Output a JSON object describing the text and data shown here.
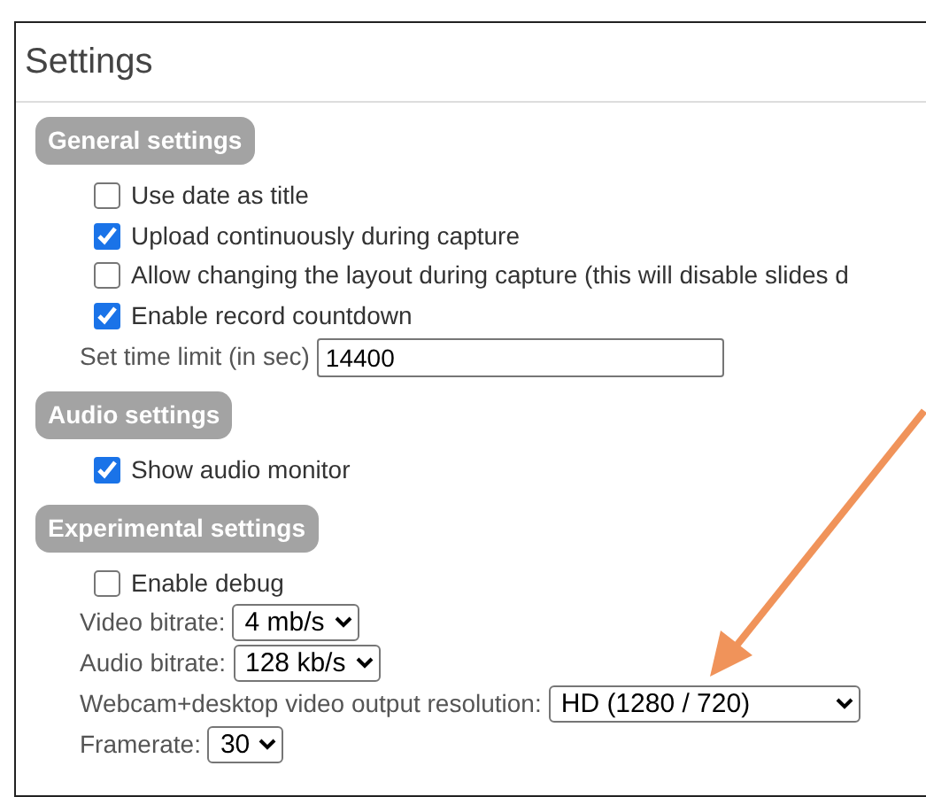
{
  "panel": {
    "title": "Settings"
  },
  "sections": [
    {
      "title": "General settings",
      "rows": [
        {
          "kind": "checkbox",
          "label": "Use date as title",
          "checked": false
        },
        {
          "kind": "checkbox",
          "label": "Upload continuously during capture",
          "checked": true
        },
        {
          "kind": "checkbox",
          "label": "Allow changing the layout during capture (this will disable slides d",
          "checked": false
        },
        {
          "kind": "checkbox",
          "label": "Enable record countdown",
          "checked": true
        },
        {
          "kind": "text",
          "label": "Set time limit (in sec)",
          "value": "14400"
        }
      ]
    },
    {
      "title": "Audio settings",
      "rows": [
        {
          "kind": "checkbox",
          "label": "Show audio monitor",
          "checked": true
        }
      ]
    },
    {
      "title": "Experimental settings",
      "rows": [
        {
          "kind": "checkbox",
          "label": "Enable debug",
          "checked": false
        },
        {
          "kind": "select",
          "label": "Video bitrate:",
          "value": "4 mb/s"
        },
        {
          "kind": "select",
          "label": "Audio bitrate:",
          "value": "128 kb/s"
        },
        {
          "kind": "select",
          "label": "Webcam+desktop video output resolution:",
          "value": "HD (1280 / 720)"
        },
        {
          "kind": "select",
          "label": "Framerate:",
          "value": "30"
        }
      ]
    }
  ]
}
